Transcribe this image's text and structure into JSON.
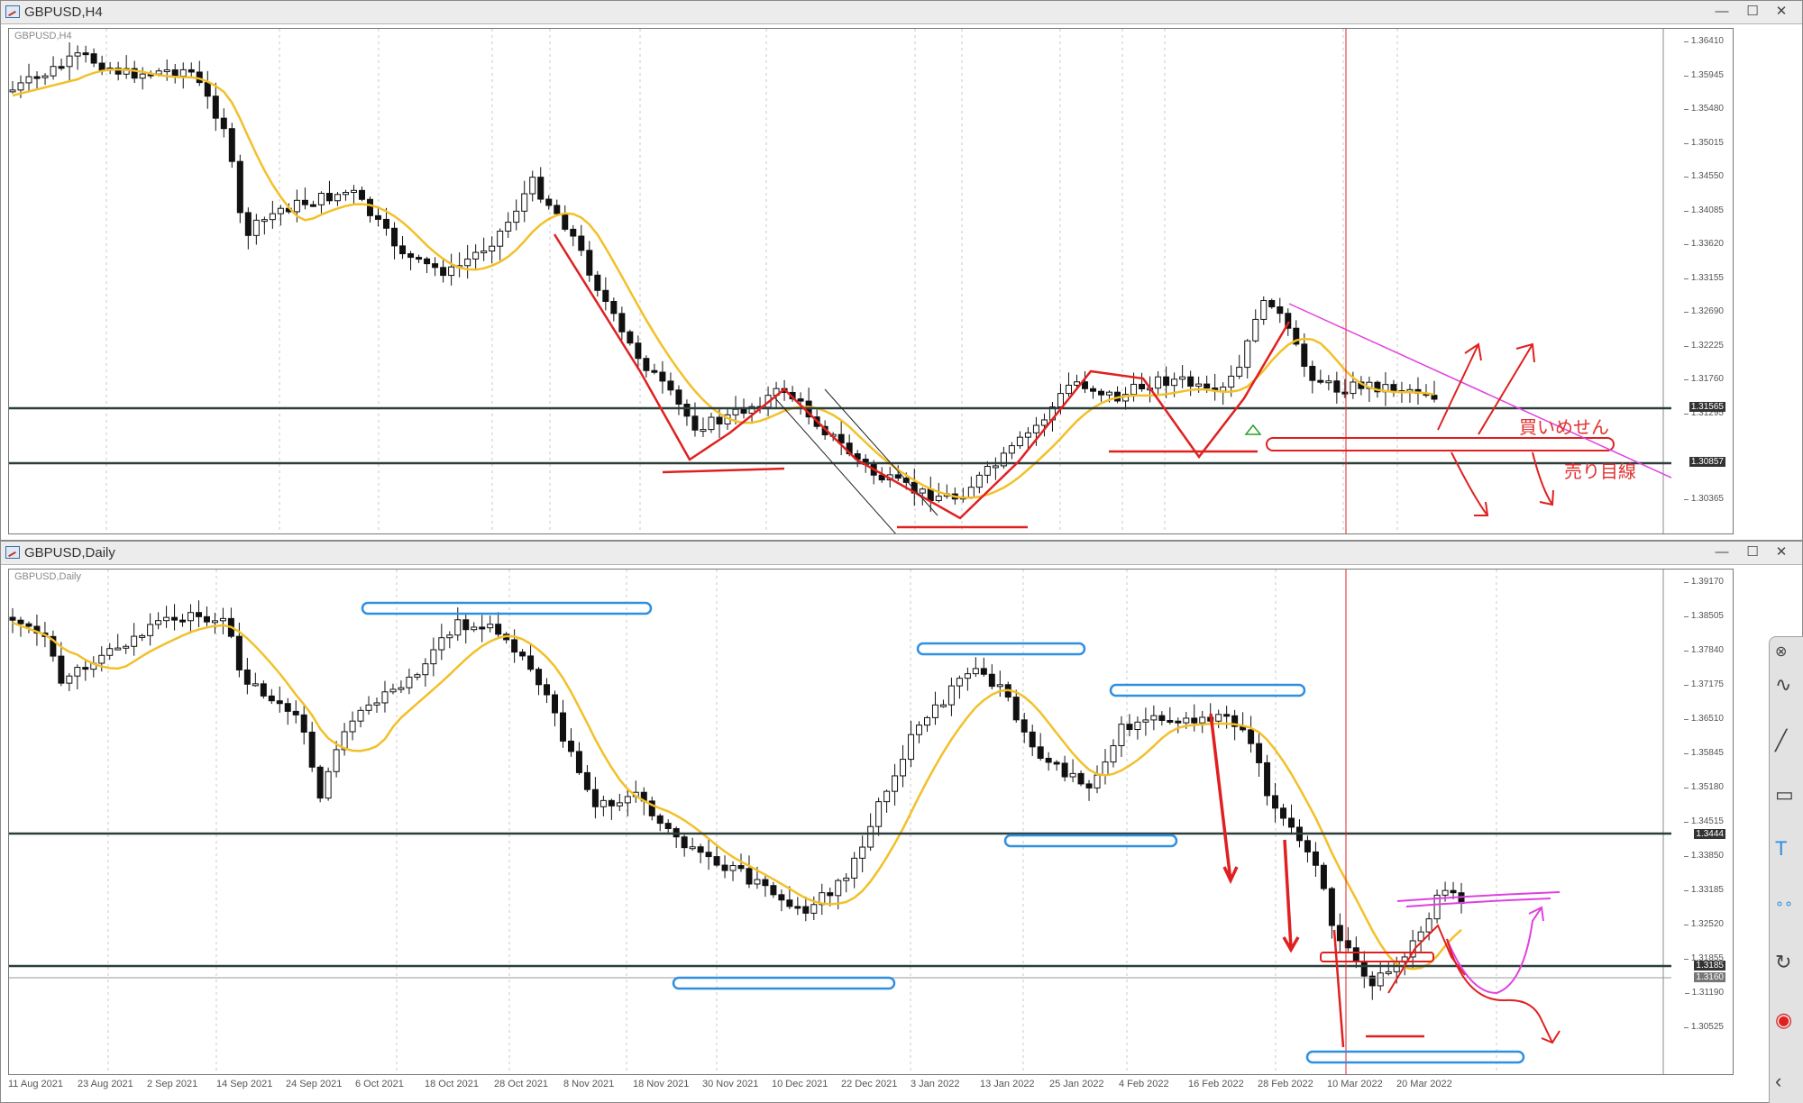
{
  "h4": {
    "title": "GBPUSD,H4",
    "symbol": "GBPUSD,H4",
    "price_labels": [
      "1.36410",
      "1.35945",
      "1.35480",
      "1.35015",
      "1.34550",
      "1.34085",
      "1.33620",
      "1.33155",
      "1.32690",
      "1.32225",
      "1.31760",
      "1.31295",
      "1.30365"
    ],
    "tag_labels": [
      "1.31565",
      "1.30857"
    ]
  },
  "daily": {
    "title": "GBPUSD,Daily",
    "symbol": "GBPUSD,Daily",
    "price_labels": [
      "1.39170",
      "1.38505",
      "1.37840",
      "1.37175",
      "1.36510",
      "1.35845",
      "1.35180",
      "1.34515",
      "1.33850",
      "1.33185",
      "1.32520",
      "1.31855",
      "1.31190",
      "1.30525"
    ],
    "tag_labels": [
      "1.3444",
      "1.3185",
      "1.3160"
    ],
    "date_labels": [
      "11 Aug 2021",
      "23 Aug 2021",
      "2 Sep 2021",
      "14 Sep 2021",
      "24 Sep 2021",
      "6 Oct 2021",
      "18 Oct 2021",
      "28 Oct 2021",
      "8 Nov 2021",
      "18 Nov 2021",
      "30 Nov 2021",
      "10 Dec 2021",
      "22 Dec 2021",
      "3 Jan 2022",
      "13 Jan 2022",
      "25 Jan 2022",
      "4 Feb 2022",
      "16 Feb 2022",
      "28 Feb 2022",
      "10 Mar 2022",
      "20 Mar 2022"
    ]
  },
  "annotations": {
    "buy_note": "買いめせん",
    "sell_target": "売り目線"
  },
  "window_buttons": {
    "minimize": "—",
    "restore": "☐",
    "close": "✕"
  },
  "toolbox": [
    "close-icon",
    "pen-icon",
    "line-icon",
    "rectangle-icon",
    "text-icon",
    "dots-icon",
    "rotate-icon",
    "color-icon",
    "back-icon"
  ],
  "colors": {
    "ma": "#f2c029",
    "trend": "#e02020",
    "zone": "#2f8fe0",
    "trendline": "#e040e0",
    "level": "#2c3e3a"
  }
}
